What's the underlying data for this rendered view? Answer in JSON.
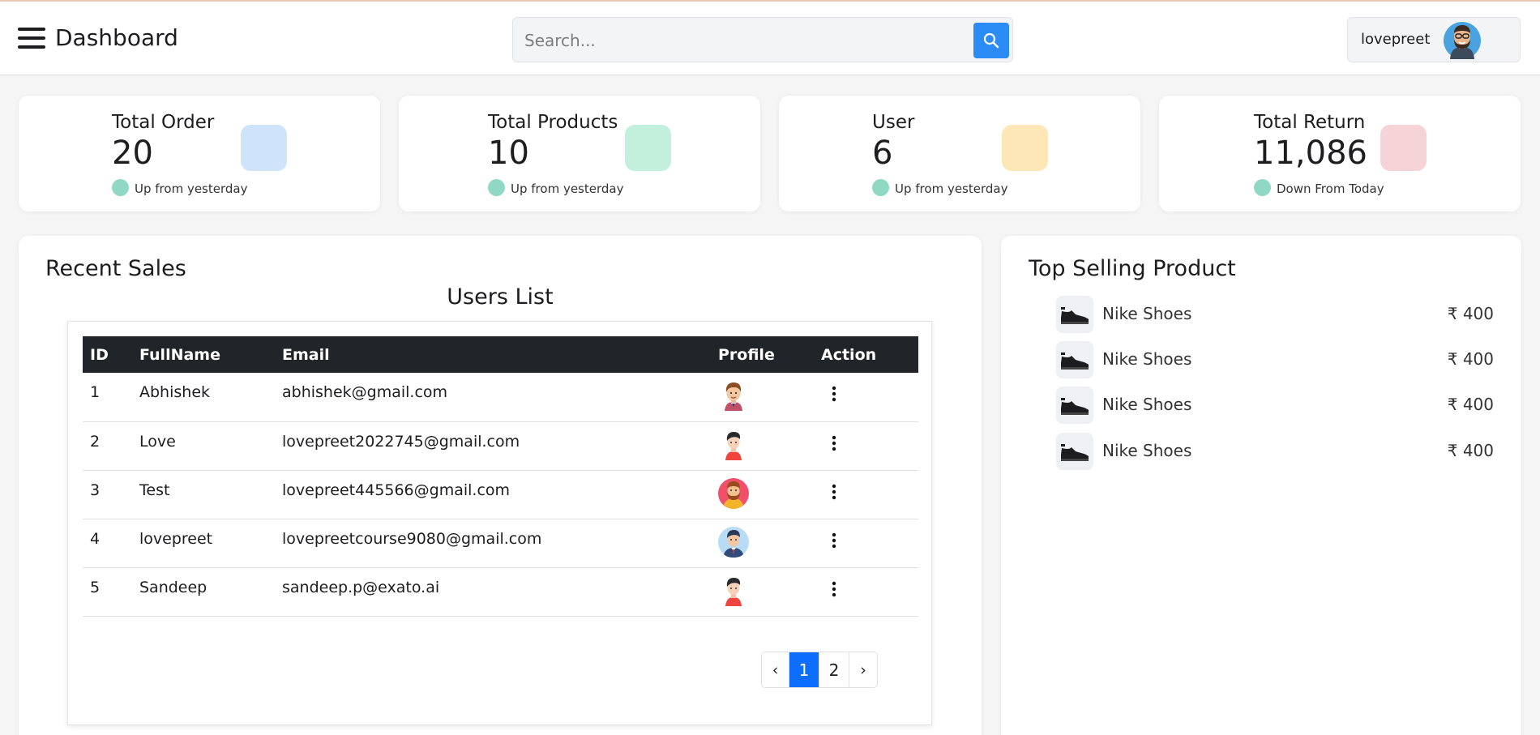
{
  "header": {
    "title": "Dashboard",
    "search_placeholder": "Search...",
    "username": "lovepreet"
  },
  "stats": [
    {
      "title": "Total Order",
      "value": "20",
      "note": "Up from yesterday",
      "icon_color": "#cfe3fb"
    },
    {
      "title": "Total Products",
      "value": "10",
      "note": "Up from yesterday",
      "icon_color": "#c3f0dc"
    },
    {
      "title": "User",
      "value": "6",
      "note": "Up from yesterday",
      "icon_color": "#fde7b6"
    },
    {
      "title": "Total Return",
      "value": "11,086",
      "note": "Down From Today",
      "icon_color": "#f6d3d7"
    }
  ],
  "recent_sales": {
    "title": "Recent Sales",
    "subtitle": "Users List",
    "columns": [
      "ID",
      "FullName",
      "Email",
      "Profile",
      "Action"
    ],
    "rows": [
      {
        "id": "1",
        "name": "Abhishek",
        "email": "abhishek@gmail.com",
        "avatar": "man-brown-hair-icon"
      },
      {
        "id": "2",
        "name": "Love",
        "email": "lovepreet2022745@gmail.com",
        "avatar": "man-red-shirt-icon"
      },
      {
        "id": "3",
        "name": "Test",
        "email": "lovepreet445566@gmail.com",
        "avatar": "bearded-man-icon"
      },
      {
        "id": "4",
        "name": "lovepreet",
        "email": "lovepreetcourse9080@gmail.com",
        "avatar": "man-suit-icon"
      },
      {
        "id": "5",
        "name": "Sandeep",
        "email": "sandeep.p@exato.ai",
        "avatar": "man-red-shirt-icon"
      }
    ],
    "pagination": {
      "prev": "‹",
      "pages": [
        "1",
        "2"
      ],
      "active": "1",
      "next": "›"
    }
  },
  "top_selling": {
    "title": "Top Selling Product",
    "items": [
      {
        "name": "Nike Shoes",
        "price": "₹ 400"
      },
      {
        "name": "Nike Shoes",
        "price": "₹ 400"
      },
      {
        "name": "Nike Shoes",
        "price": "₹ 400"
      },
      {
        "name": "Nike Shoes",
        "price": "₹ 400"
      }
    ]
  },
  "colors": {
    "accent": "#2b8cf5",
    "pagination_active": "#0d6efd",
    "table_header": "#212529",
    "status_dot": "#8fd8c4"
  }
}
